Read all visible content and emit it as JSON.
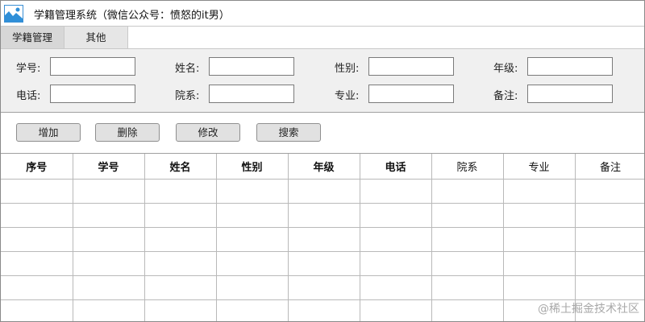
{
  "window": {
    "title": "学籍管理系统（微信公众号：愤怒的it男）"
  },
  "menu": {
    "items": [
      {
        "label": "学籍管理"
      },
      {
        "label": "其他"
      }
    ]
  },
  "form": {
    "fields": [
      {
        "label": "学号:",
        "value": ""
      },
      {
        "label": "姓名:",
        "value": ""
      },
      {
        "label": "性别:",
        "value": ""
      },
      {
        "label": "年级:",
        "value": ""
      },
      {
        "label": "电话:",
        "value": ""
      },
      {
        "label": "院系:",
        "value": ""
      },
      {
        "label": "专业:",
        "value": ""
      },
      {
        "label": "备注:",
        "value": ""
      }
    ]
  },
  "actions": {
    "add": "增加",
    "delete": "删除",
    "modify": "修改",
    "search": "搜索"
  },
  "table": {
    "columns": [
      "序号",
      "学号",
      "姓名",
      "性别",
      "年级",
      "电话",
      "院系",
      "专业",
      "备注"
    ],
    "rows": []
  },
  "watermark": "@稀土掘金技术社区"
}
